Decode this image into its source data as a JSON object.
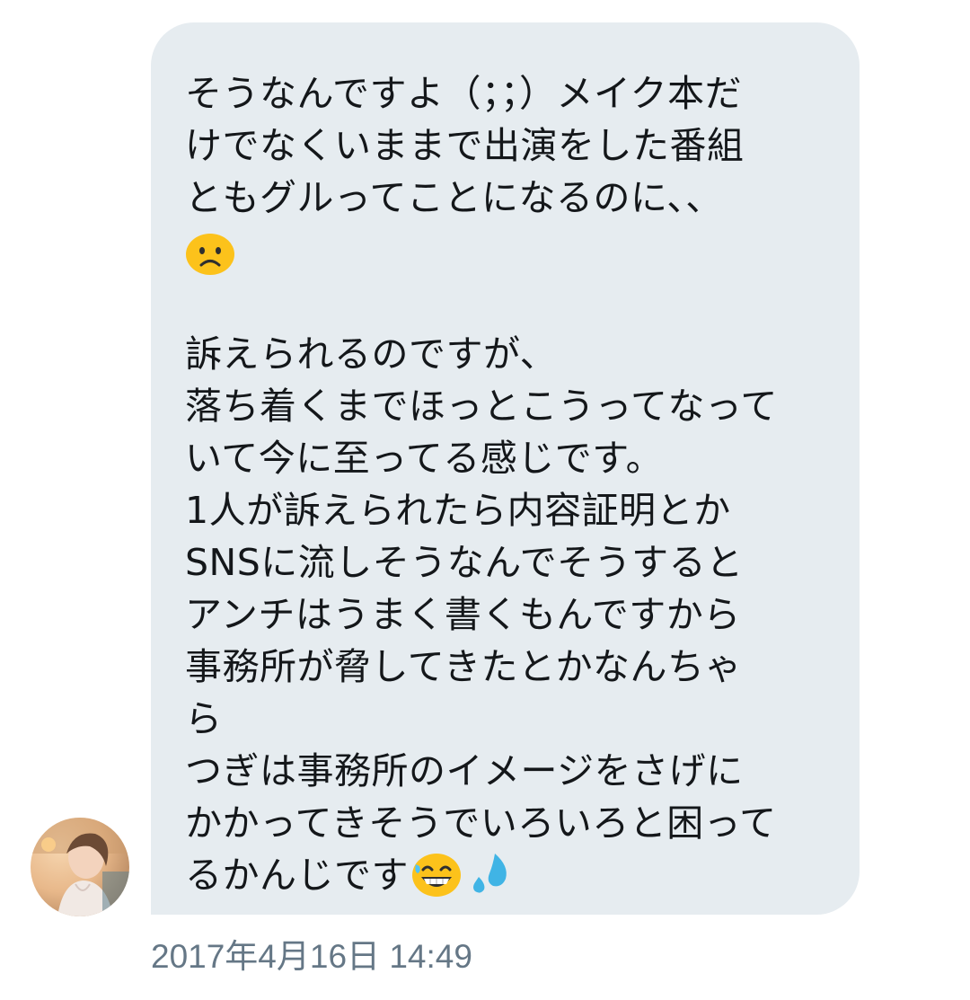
{
  "message": {
    "lines": [
      "そうなんですよ（；；）メイク本だ",
      "けでなくいままで出演をした番組",
      "ともグルってことになるのに、、",
      "",
      "",
      "訴えられるのですが、",
      "落ち着くまでほっとこうってなって",
      "いて今に至ってる感じです。",
      "1人が訴えられたら内容証明とか",
      "SNSに流しそうなんでそうすると",
      "アンチはうまく書くもんですから",
      "事務所が脅してきたとかなんちゃ",
      "ら",
      "つぎは事務所のイメージをさげに",
      "かかってきそうでいろいろと困って",
      "るかんじです"
    ],
    "emojis": [
      "frowning-face",
      "grinning-sweat-face",
      "sweat-droplets"
    ]
  },
  "timestamp": "2017年4月16日 14:49",
  "colors": {
    "bubble_bg": "#e6ecf0",
    "text": "#14171a",
    "timestamp": "#657786"
  }
}
